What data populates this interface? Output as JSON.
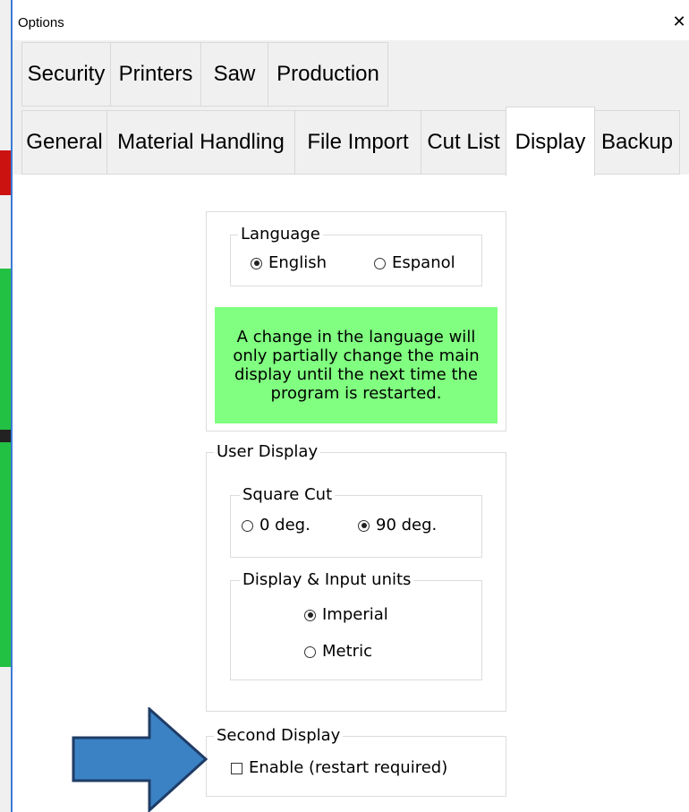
{
  "window": {
    "title": "Options",
    "close_glyph": "✕"
  },
  "tabs_row1": [
    "Security",
    "Printers",
    "Saw",
    "Production"
  ],
  "tabs_row2": [
    "General",
    "Material Handling",
    "File Import",
    "Cut List",
    "Display",
    "Backup"
  ],
  "selected_tab": "Display",
  "language": {
    "legend": "Language",
    "options": [
      {
        "label": "English",
        "selected": true
      },
      {
        "label": "Espanol",
        "selected": false
      }
    ],
    "note": "A change in the language will only partially change the main display until the next time the program is restarted.",
    "note_color": "#80ff80"
  },
  "user_display": {
    "legend": "User Display",
    "square_cut": {
      "legend": "Square Cut",
      "options": [
        {
          "label": "0 deg.",
          "selected": false
        },
        {
          "label": "90 deg.",
          "selected": true
        }
      ]
    },
    "units": {
      "legend": "Display & Input units",
      "options": [
        {
          "label": "Imperial",
          "selected": true
        },
        {
          "label": "Metric",
          "selected": false
        }
      ]
    }
  },
  "second_display": {
    "legend": "Second Display",
    "checkbox": {
      "label": "Enable (restart required)",
      "checked": false
    }
  },
  "annotation": {
    "arrow_icon": "blue-arrow-icon",
    "arrow_color": "#3b82c4"
  }
}
